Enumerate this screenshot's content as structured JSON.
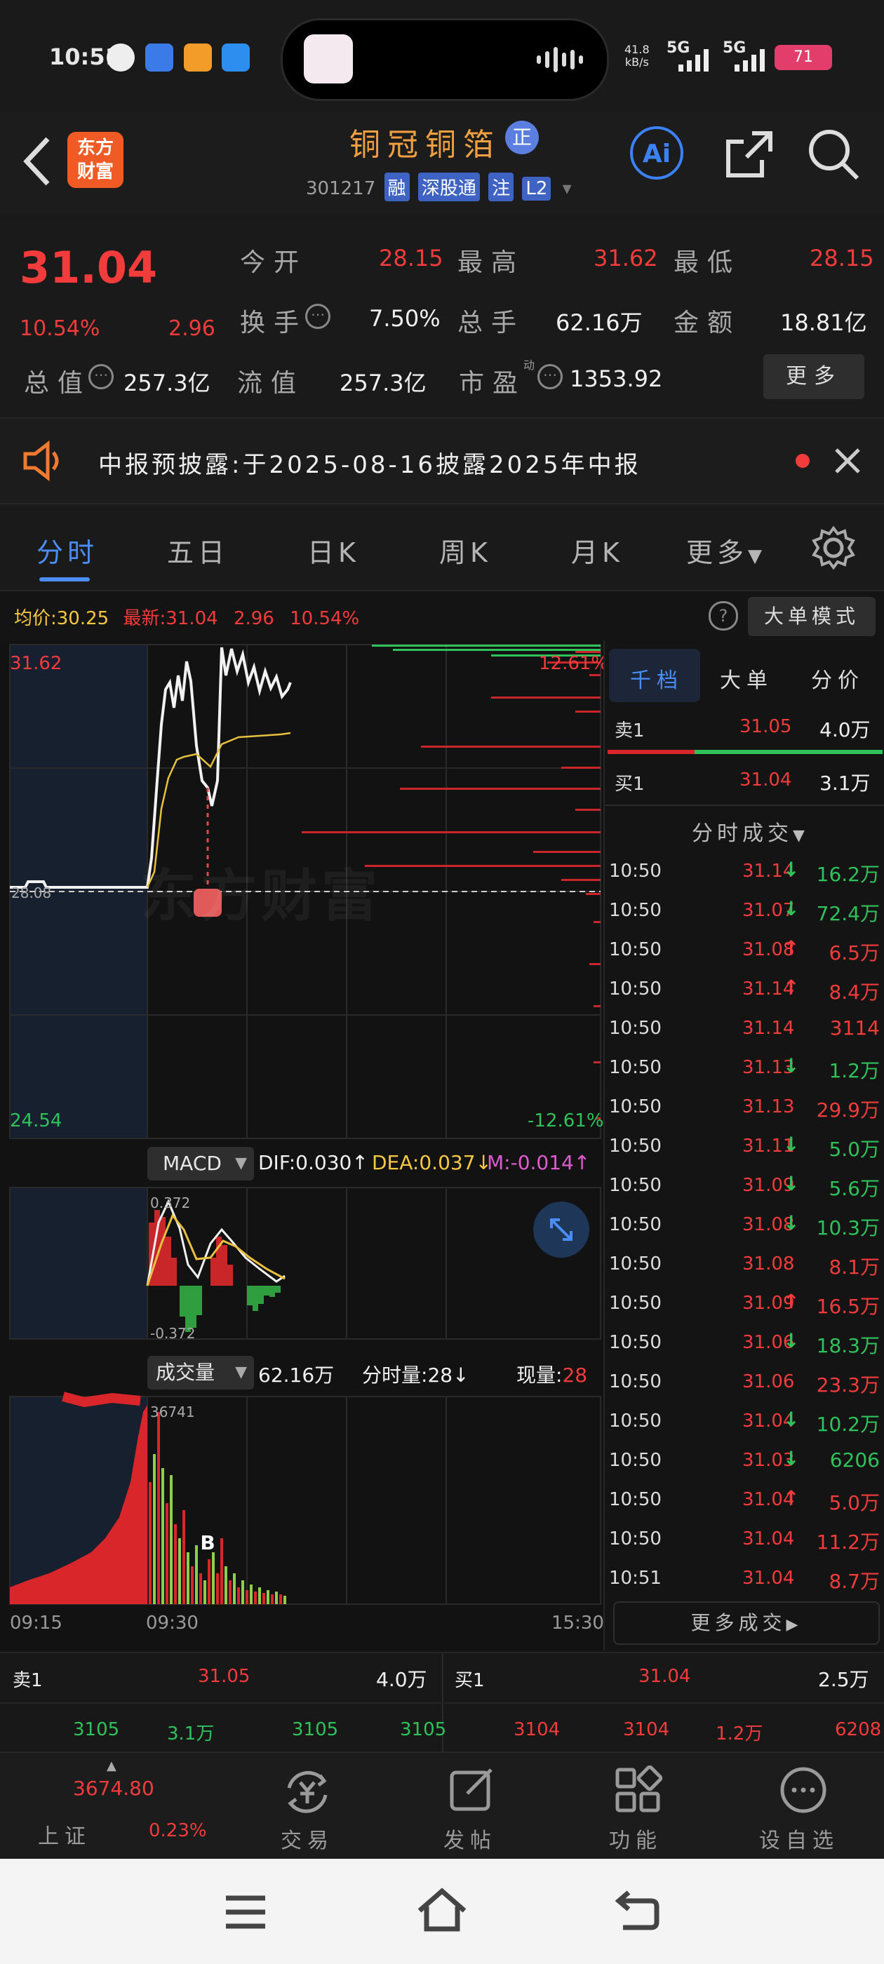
{
  "status_bar": {
    "time": "10:51",
    "net_speed": "41.8",
    "net_unit": "kB/s",
    "sim1": "5G",
    "sim2": "5G",
    "battery": "71"
  },
  "header": {
    "logo_line1": "东方",
    "logo_line2": "财富",
    "stock_name": "铜冠铜箔",
    "name_badge": "正",
    "stock_code": "301217",
    "tags": [
      "融",
      "深股通",
      "注",
      "L2"
    ],
    "ai_label": "Ai"
  },
  "quote": {
    "price": "31.04",
    "change_pct": "10.54%",
    "change_abs": "2.96",
    "open_label": "今开",
    "open_value": "28.15",
    "high_label": "最高",
    "high_value": "31.62",
    "low_label": "最低",
    "low_value": "28.15",
    "turnover_label": "换手",
    "turnover_value": "7.50%",
    "volume_label": "总手",
    "volume_value": "62.16万",
    "amount_label": "金额",
    "amount_value": "18.81亿",
    "mktcap_label": "总值",
    "mktcap_value": "257.3亿",
    "float_label": "流值",
    "float_value": "257.3亿",
    "pe_label": "市盈",
    "pe_sup": "动",
    "pe_value": "1353.92",
    "more_button": "更多"
  },
  "notice": {
    "text": "中报预披露:于2025-08-16披露2025年中报"
  },
  "tabs": [
    "分时",
    "五日",
    "日K",
    "周K",
    "月K",
    "更多"
  ],
  "chart_bar": {
    "avg_label": "均价:",
    "avg_value": "30.25",
    "latest_label": "最新:",
    "latest_value": "31.04",
    "latest_change": "2.96",
    "latest_pct": "10.54%",
    "mode_button": "大单模式"
  },
  "chart_labels": {
    "y_top": "31.62",
    "y_bottom": "24.54",
    "pct_top": "12.61%",
    "pct_bottom": "-12.61%",
    "prev_close": "28.08",
    "signal": "B",
    "watermark": "东方财富",
    "macd_button": "MACD",
    "dif": "DIF:0.030",
    "dea": "DEA:0.037",
    "m": "M:-0.014",
    "macd_top": "0.372",
    "macd_bottom": "-0.372",
    "vol_button": "成交量",
    "vol_total": "62.16万",
    "vol_min_label": "分时量:",
    "vol_min_value": "28",
    "vol_now_label": "现量:",
    "vol_now_value": "28",
    "vol_max": "36741",
    "t_start": "09:15",
    "t_open": "09:30",
    "t_end": "15:30"
  },
  "side": {
    "tabs": [
      "千档",
      "大单",
      "分价"
    ],
    "sell1_label": "卖1",
    "sell1_price": "31.05",
    "sell1_vol": "4.0万",
    "buy1_label": "买1",
    "buy1_price": "31.04",
    "buy1_vol": "3.1万",
    "trades_title": "分时成交",
    "more_trades": "更多成交"
  },
  "trades": [
    {
      "time": "10:50",
      "price": "31.14",
      "dir": "down",
      "vol": "16.2万"
    },
    {
      "time": "10:50",
      "price": "31.07",
      "dir": "down",
      "vol": "72.4万"
    },
    {
      "time": "10:50",
      "price": "31.08",
      "dir": "up",
      "vol": "6.5万"
    },
    {
      "time": "10:50",
      "price": "31.14",
      "dir": "up",
      "vol": "8.4万"
    },
    {
      "time": "10:50",
      "price": "31.14",
      "dir": "",
      "vol": "3114"
    },
    {
      "time": "10:50",
      "price": "31.13",
      "dir": "down",
      "vol": "1.2万"
    },
    {
      "time": "10:50",
      "price": "31.13",
      "dir": "",
      "vol": "29.9万"
    },
    {
      "time": "10:50",
      "price": "31.11",
      "dir": "down",
      "vol": "5.0万"
    },
    {
      "time": "10:50",
      "price": "31.09",
      "dir": "down",
      "vol": "5.6万"
    },
    {
      "time": "10:50",
      "price": "31.08",
      "dir": "down",
      "vol": "10.3万"
    },
    {
      "time": "10:50",
      "price": "31.08",
      "dir": "",
      "vol": "8.1万"
    },
    {
      "time": "10:50",
      "price": "31.09",
      "dir": "up",
      "vol": "16.5万"
    },
    {
      "time": "10:50",
      "price": "31.06",
      "dir": "down",
      "vol": "18.3万"
    },
    {
      "time": "10:50",
      "price": "31.06",
      "dir": "",
      "vol": "23.3万"
    },
    {
      "time": "10:50",
      "price": "31.04",
      "dir": "down",
      "vol": "10.2万"
    },
    {
      "time": "10:50",
      "price": "31.03",
      "dir": "down",
      "vol": "6206"
    },
    {
      "time": "10:50",
      "price": "31.04",
      "dir": "up",
      "vol": "5.0万"
    },
    {
      "time": "10:50",
      "price": "31.04",
      "dir": "",
      "vol": "11.2万"
    },
    {
      "time": "10:51",
      "price": "31.04",
      "dir": "",
      "vol": "8.7万"
    }
  ],
  "order_bar": {
    "sell_label": "卖1",
    "sell_price": "31.05",
    "sell_vol": "4.0万",
    "buy_label": "买1",
    "buy_price": "31.04",
    "buy_vol": "2.5万",
    "sell_queue": [
      "3105",
      "3.1万",
      "3105",
      "3105"
    ],
    "buy_queue": [
      "3104",
      "3104",
      "1.2万",
      "6208"
    ]
  },
  "bottom_nav": {
    "index_value": "3674.80",
    "index_name": "上证",
    "index_pct": "0.23%",
    "items": [
      "交易",
      "发帖",
      "功能",
      "设自选"
    ]
  }
}
